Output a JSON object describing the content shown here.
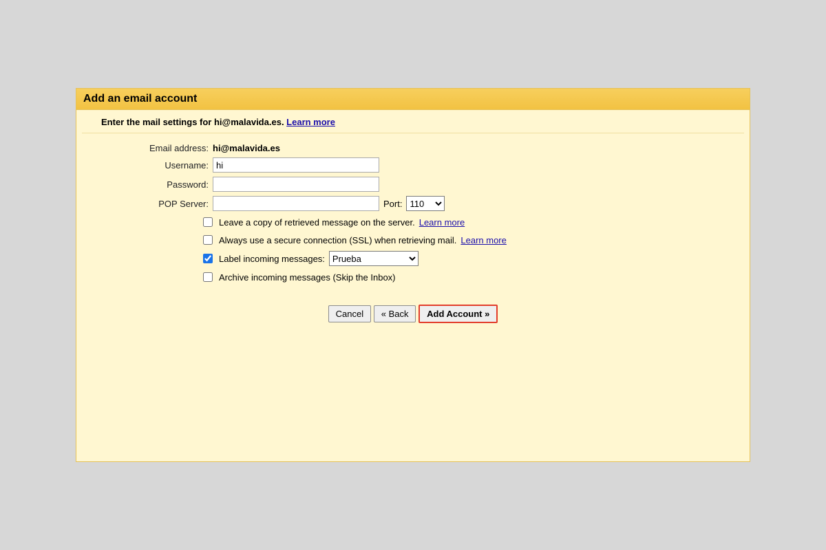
{
  "dialog": {
    "title": "Add an email account",
    "subheader_prefix": "Enter the mail settings for ",
    "subheader_email": "hi@malavida.es",
    "subheader_suffix": ". ",
    "learn_more": "Learn more"
  },
  "form": {
    "email_label": "Email address:",
    "email_value": "hi@malavida.es",
    "username_label": "Username:",
    "username_value": "hi",
    "password_label": "Password:",
    "password_value": "",
    "pop_label": "POP Server:",
    "pop_value": "",
    "port_label": "Port:",
    "port_value": "110"
  },
  "options": {
    "leave_copy": "Leave a copy of retrieved message on the server.",
    "leave_copy_checked": false,
    "ssl": "Always use a secure connection (SSL) when retrieving mail.",
    "ssl_checked": false,
    "label_incoming": "Label incoming messages:",
    "label_incoming_checked": true,
    "label_value": "Prueba",
    "archive": "Archive incoming messages (Skip the Inbox)",
    "archive_checked": false,
    "learn_more": "Learn more"
  },
  "buttons": {
    "cancel": "Cancel",
    "back": "« Back",
    "add": "Add Account »"
  }
}
